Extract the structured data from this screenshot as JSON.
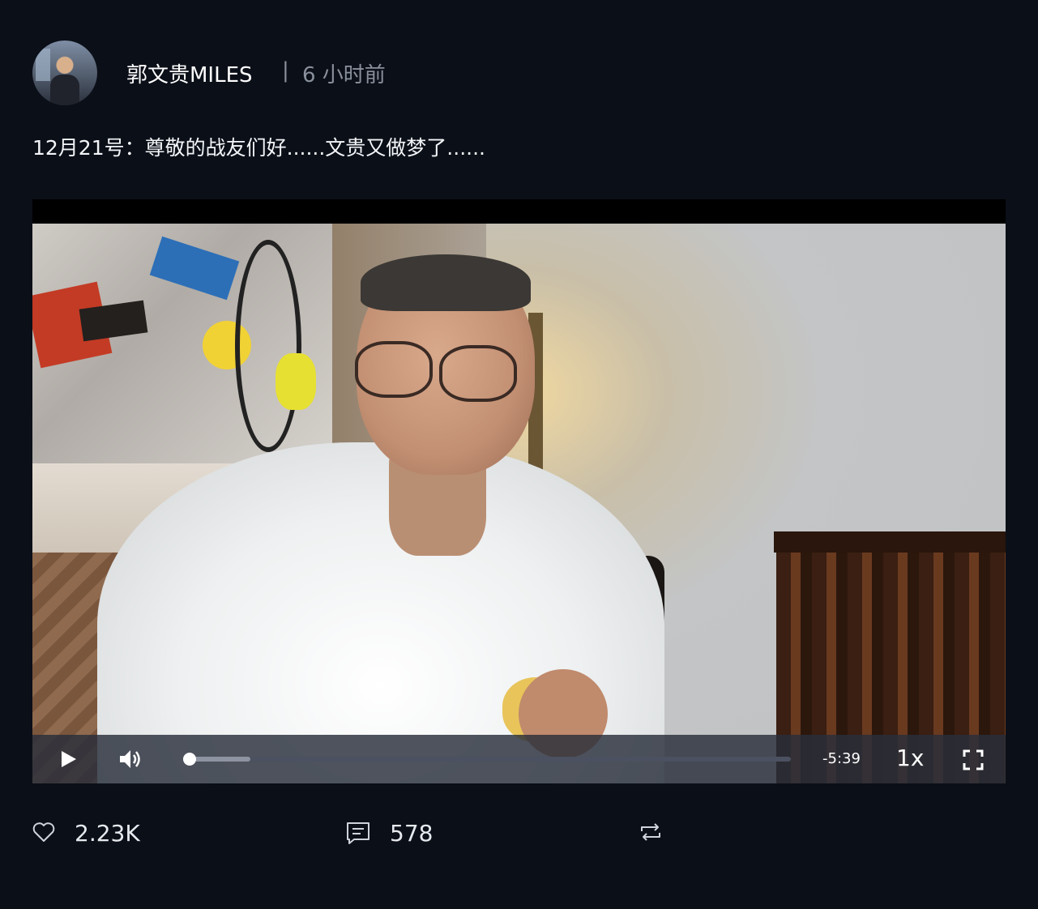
{
  "post": {
    "author": "郭文贵MILES",
    "separator": "|",
    "time": "6 小时前",
    "text": "12月21号：尊敬的战友们好......文贵又做梦了......"
  },
  "video": {
    "remaining": "-5:39",
    "speed": "1x",
    "progress_played_fraction": 0.01,
    "progress_buffered_fraction": 0.11
  },
  "actions": {
    "likes": "2.23K",
    "comments": "578"
  },
  "icons": {
    "like": "heart-icon",
    "comment": "comment-icon",
    "repost": "repost-icon",
    "play": "play-icon",
    "volume": "volume-icon",
    "fullscreen": "fullscreen-icon"
  },
  "colors": {
    "background": "#0b0f18",
    "muted_text": "#8a919c"
  }
}
